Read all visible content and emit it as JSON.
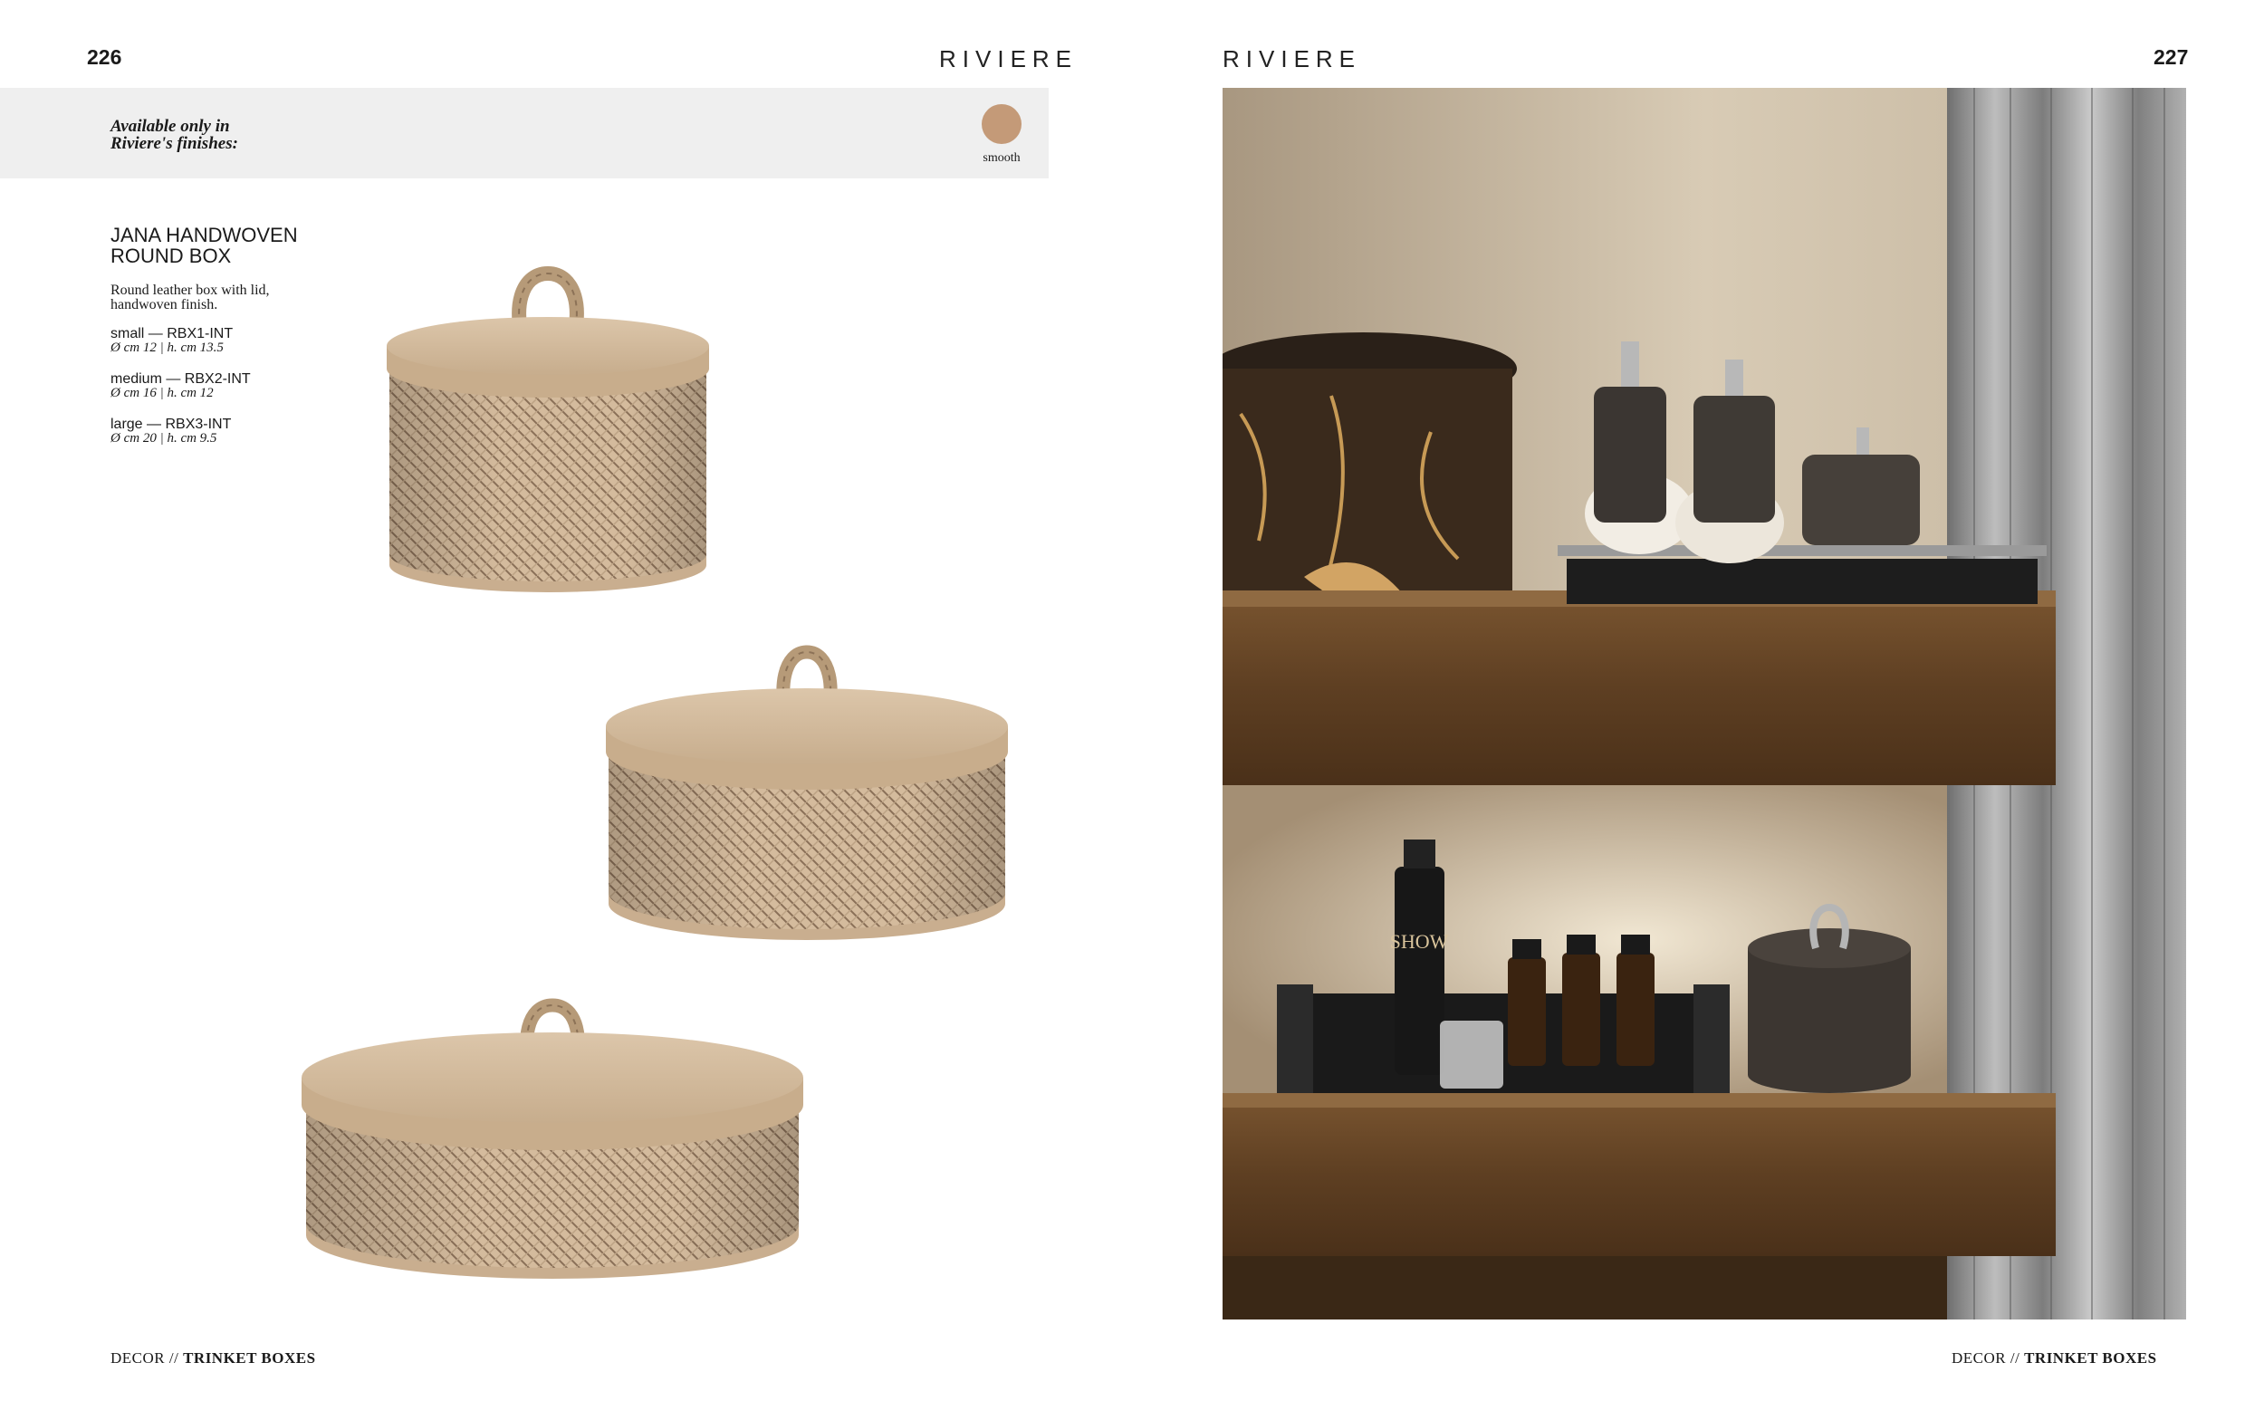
{
  "left_page": {
    "page_number": "226",
    "brand": "RIVIERE",
    "finishes": {
      "available_label": "Available only in Riviere's finishes:",
      "swatch": {
        "name": "smooth",
        "color": "#c49a78"
      }
    },
    "product": {
      "title": "JANA HANDWOVEN ROUND BOX",
      "description": "Round leather box with lid, handwoven finish.",
      "sizes": [
        {
          "name": "small — RBX1-INT",
          "dims": "Ø cm 12 | h. cm 13.5"
        },
        {
          "name": "medium — RBX2-INT",
          "dims": "Ø cm 16 | h. cm 12"
        },
        {
          "name": "large — RBX3-INT",
          "dims": "Ø cm 20 | h. cm 9.5"
        }
      ]
    },
    "footer": {
      "section": "DECOR",
      "separator": " // ",
      "category": "TRINKET BOXES"
    }
  },
  "right_page": {
    "page_number": "227",
    "brand": "RIVIERE",
    "photo_label": "SHOW",
    "footer": {
      "section": "DECOR",
      "separator": " // ",
      "category": "TRINKET BOXES"
    }
  },
  "colors": {
    "leather": "#d2b99b",
    "leather_dark": "#a88d70",
    "finish_bar": "#efefef",
    "wood": "#6b4a2a"
  }
}
